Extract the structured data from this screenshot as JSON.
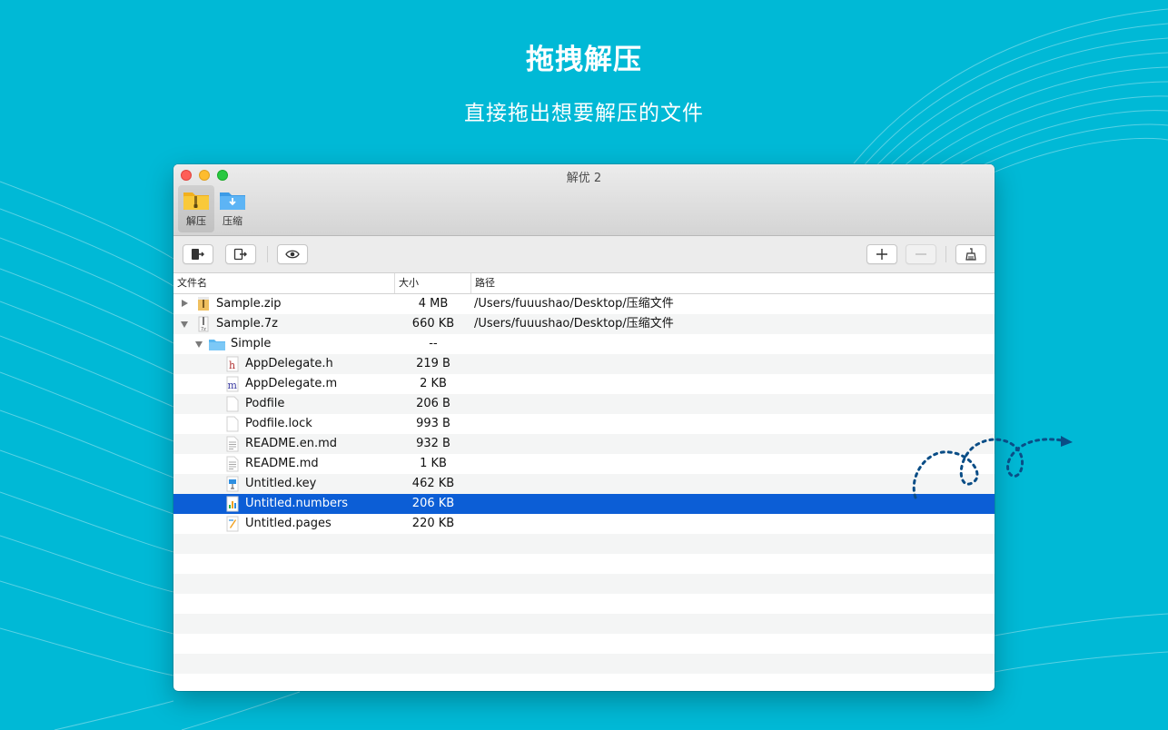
{
  "banner": {
    "title": "拖拽解压",
    "subtitle": "直接拖出想要解压的文件"
  },
  "window": {
    "title": "解优 2",
    "tabs": [
      {
        "label": "解压",
        "icon": "zip-folder-icon",
        "active": true
      },
      {
        "label": "压缩",
        "icon": "download-folder-icon",
        "active": false
      }
    ],
    "toolbar": {
      "buttons": [
        "extract-icon",
        "export-icon",
        "preview-eye-icon",
        "plus-icon",
        "minus-icon",
        "clean-broom-icon"
      ]
    }
  },
  "table": {
    "columns": [
      "文件名",
      "大小",
      "路径"
    ],
    "rows": [
      {
        "name": "Sample.zip",
        "size": "4 MB",
        "path": "/Users/fuuushao/Desktop/压缩文件",
        "icon": "zip-file-icon",
        "disclosure": "collapsed"
      },
      {
        "name": "Sample.7z",
        "size": "660 KB",
        "path": "/Users/fuuushao/Desktop/压缩文件",
        "icon": "archive-7z-icon",
        "disclosure": "expanded"
      },
      {
        "name": "Simple",
        "size": "--",
        "path": "",
        "icon": "folder-icon",
        "disclosure": "expanded"
      },
      {
        "name": "AppDelegate.h",
        "size": "219 B",
        "path": "",
        "icon": "header-file-icon"
      },
      {
        "name": "AppDelegate.m",
        "size": "2 KB",
        "path": "",
        "icon": "objc-file-icon"
      },
      {
        "name": "Podfile",
        "size": "206 B",
        "path": "",
        "icon": "document-icon"
      },
      {
        "name": "Podfile.lock",
        "size": "993 B",
        "path": "",
        "icon": "document-icon"
      },
      {
        "name": "README.en.md",
        "size": "932 B",
        "path": "",
        "icon": "text-document-icon"
      },
      {
        "name": "README.md",
        "size": "1 KB",
        "path": "",
        "icon": "text-document-icon"
      },
      {
        "name": "Untitled.key",
        "size": "462 KB",
        "path": "",
        "icon": "keynote-file-icon"
      },
      {
        "name": "Untitled.numbers",
        "size": "206 KB",
        "path": "",
        "icon": "numbers-file-icon",
        "selected": true
      },
      {
        "name": "Untitled.pages",
        "size": "220 KB",
        "path": "",
        "icon": "pages-file-icon"
      }
    ]
  },
  "colors": {
    "background": "#00b9d6",
    "selection": "#0c5ed6",
    "drag_path": "#0a4d86"
  }
}
